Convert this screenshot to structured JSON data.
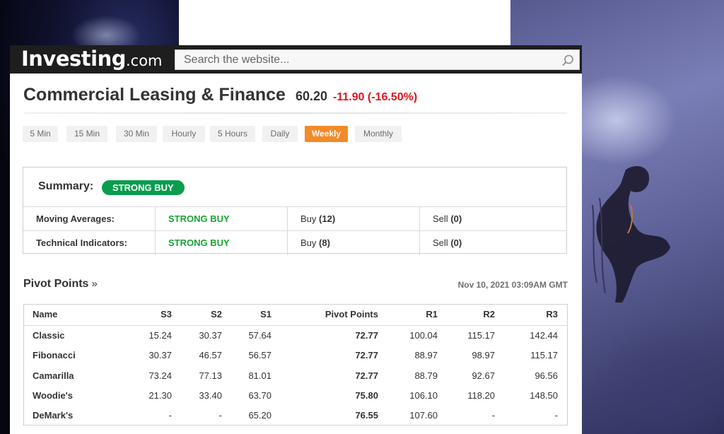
{
  "header": {
    "logo_main": "Investing",
    "logo_suffix": ".com",
    "search_placeholder": "Search the website..."
  },
  "instrument": {
    "name": "Commercial Leasing & Finance",
    "price": "60.20",
    "change": "-11.90 (-16.50%)"
  },
  "timeframes": [
    "5 Min",
    "15 Min",
    "30 Min",
    "Hourly",
    "5 Hours",
    "Daily",
    "Weekly",
    "Monthly"
  ],
  "active_timeframe": "Weekly",
  "summary": {
    "label": "Summary:",
    "badge": "STRONG BUY",
    "rows": [
      {
        "label": "Moving Averages:",
        "signal": "STRONG BUY",
        "buy_label": "Buy",
        "buy_count": "(12)",
        "sell_label": "Sell",
        "sell_count": "(0)"
      },
      {
        "label": "Technical Indicators:",
        "signal": "STRONG BUY",
        "buy_label": "Buy",
        "buy_count": "(8)",
        "sell_label": "Sell",
        "sell_count": "(0)"
      }
    ]
  },
  "pivot": {
    "title": "Pivot Points",
    "arrow": "»",
    "timestamp": "Nov 10, 2021 03:09AM GMT",
    "columns": [
      "Name",
      "S3",
      "S2",
      "S1",
      "Pivot Points",
      "R1",
      "R2",
      "R3"
    ],
    "rows": [
      [
        "Classic",
        "15.24",
        "30.37",
        "57.64",
        "72.77",
        "100.04",
        "115.17",
        "142.44"
      ],
      [
        "Fibonacci",
        "30.37",
        "46.57",
        "56.57",
        "72.77",
        "88.97",
        "98.97",
        "115.17"
      ],
      [
        "Camarilla",
        "73.24",
        "77.13",
        "81.01",
        "72.77",
        "88.79",
        "92.67",
        "96.56"
      ],
      [
        "Woodie's",
        "21.30",
        "33.40",
        "63.70",
        "75.80",
        "106.10",
        "118.20",
        "148.50"
      ],
      [
        "DeMark's",
        "-",
        "-",
        "65.20",
        "76.55",
        "107.60",
        "-",
        "-"
      ]
    ]
  },
  "colors": {
    "accent_orange": "#f38a28",
    "buy_green": "#1ba233",
    "badge_green": "#0a9d4e",
    "negative_red": "#e0131d",
    "topbar": "#1e1e1e"
  }
}
